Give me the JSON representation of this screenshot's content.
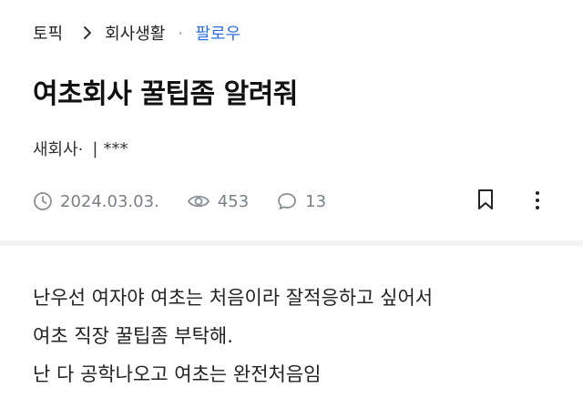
{
  "breadcrumb": {
    "topic": "토픽",
    "category": "회사생활",
    "separator": "·",
    "follow": "팔로우"
  },
  "post": {
    "title": "여초회사 꿀팁좀 알려줘",
    "author_company": "새회사·",
    "author_divider": "|",
    "author_name": "***",
    "date": "2024.03.03.",
    "views": "453",
    "comments": "13",
    "body": [
      "난우선 여자야 여초는 처음이라 잘적응하고 싶어서",
      "여초 직장 꿀팁좀 부탁해.",
      "난 다 공학나오고 여초는 완전처음임"
    ]
  },
  "icons": {
    "chevron": "chevron-right-icon",
    "date": "clock-icon",
    "views": "eye-icon",
    "comments": "comment-icon",
    "bookmark": "bookmark-icon",
    "more": "more-vertical-icon"
  },
  "colors": {
    "accent": "#2f6fe0",
    "meta": "#7b8088",
    "divider": "#f2f3f5"
  }
}
